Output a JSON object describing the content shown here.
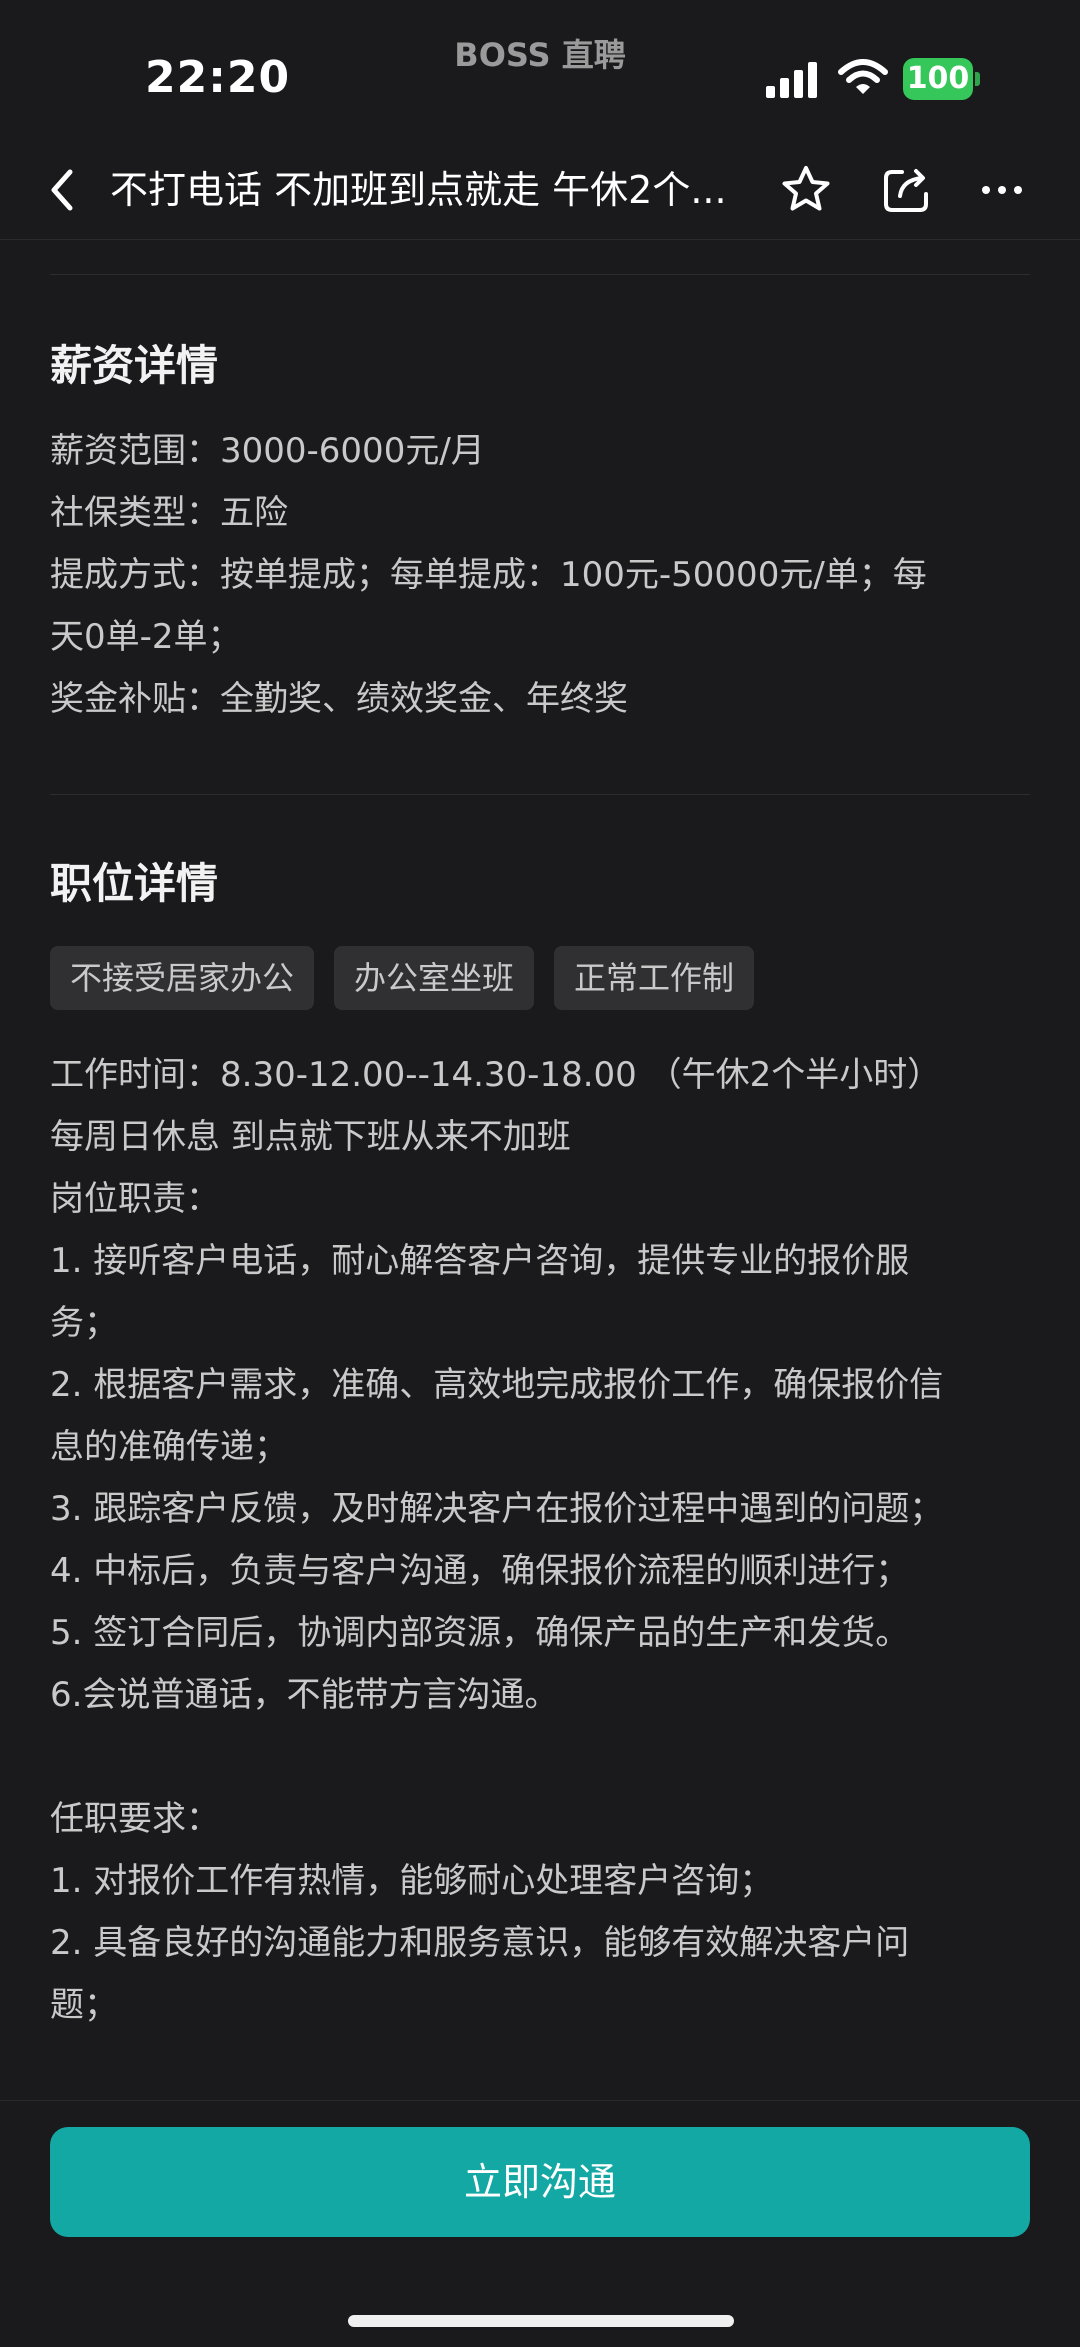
{
  "status_bar": {
    "time": "22:20",
    "app_name": "BOSS 直聘",
    "battery": "100",
    "battery_color": "#35c759"
  },
  "nav": {
    "title": "不打电话 不加班到点就走 午休2个...",
    "icons": [
      "back-icon",
      "star-icon",
      "share-icon",
      "more-icon"
    ]
  },
  "salary": {
    "title": "薪资详情",
    "lines": [
      "薪资范围：3000-6000元/月",
      "社保类型：五险",
      "提成方式：按单提成；每单提成：100元-50000元/单；每",
      "天0单-2单；",
      "奖金补贴：全勤奖、绩效奖金、年终奖"
    ]
  },
  "position": {
    "title": "职位详情",
    "tags": [
      "不接受居家办公",
      "办公室坐班",
      "正常工作制"
    ],
    "lines": [
      "工作时间：8.30-12.00--14.30-18.00 （午休2个半小时）",
      "每周日休息 到点就下班从来不加班",
      "岗位职责：",
      "1. 接听客户电话，耐心解答客户咨询，提供专业的报价服",
      "务；",
      "2. 根据客户需求，准确、高效地完成报价工作，确保报价信",
      "息的准确传递；",
      "3. 跟踪客户反馈，及时解决客户在报价过程中遇到的问题；",
      "4. 中标后，负责与客户沟通，确保报价流程的顺利进行；",
      "5. 签订合同后，协调内部资源，确保产品的生产和发货。",
      "6.会说普通话，不能带方言沟通。",
      "",
      "任职要求：",
      "1. 对报价工作有热情，能够耐心处理客户咨询；",
      "2. 具备良好的沟通能力和服务意识，能够有效解决客户问",
      "题；"
    ]
  },
  "cta": {
    "label": "立即沟通",
    "color": "#13a8a3"
  }
}
